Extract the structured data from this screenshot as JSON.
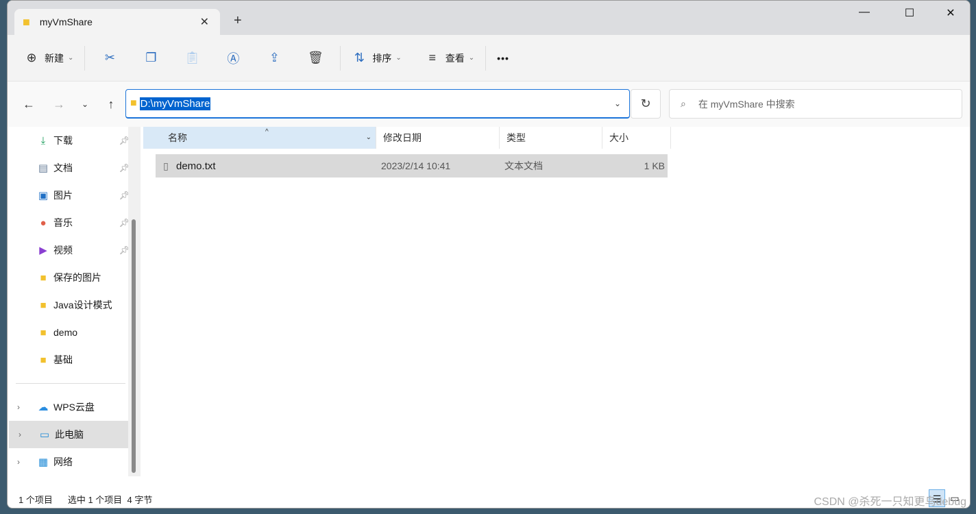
{
  "window": {
    "tab_title": "myVmShare",
    "new_tab": "+",
    "minimize": "—",
    "maximize": "☐",
    "close": "✕"
  },
  "toolbar": {
    "new_label": "新建",
    "sort_label": "排序",
    "view_label": "查看",
    "more": "•••",
    "icons": [
      "cut-icon",
      "copy-icon",
      "paste-icon",
      "rename-icon",
      "share-icon",
      "delete-icon"
    ]
  },
  "nav": {
    "address": "D:\\myVmShare",
    "search_placeholder": "在 myVmShare 中搜索"
  },
  "sidebar": {
    "quick": [
      {
        "label": "下载",
        "icon": "download-icon",
        "pinned": true
      },
      {
        "label": "文档",
        "icon": "documents-icon",
        "pinned": true
      },
      {
        "label": "图片",
        "icon": "pictures-icon",
        "pinned": true
      },
      {
        "label": "音乐",
        "icon": "music-icon",
        "pinned": true
      },
      {
        "label": "视频",
        "icon": "videos-icon",
        "pinned": true
      },
      {
        "label": "保存的图片",
        "icon": "folder-icon"
      },
      {
        "label": "Java设计模式",
        "icon": "folder-icon"
      },
      {
        "label": "demo",
        "icon": "folder-icon"
      },
      {
        "label": "基础",
        "icon": "folder-icon"
      }
    ],
    "roots": [
      {
        "label": "WPS云盘",
        "icon": "cloud-icon"
      },
      {
        "label": "此电脑",
        "icon": "computer-icon",
        "active": true
      },
      {
        "label": "网络",
        "icon": "network-icon"
      }
    ]
  },
  "columns": {
    "name": "名称",
    "modified": "修改日期",
    "type": "类型",
    "size": "大小"
  },
  "files": [
    {
      "name": "demo.txt",
      "modified": "2023/2/14 10:41",
      "type": "文本文档",
      "size": "1 KB"
    }
  ],
  "status": {
    "count": "1 个项目",
    "selected": "选中 1 个项目  4 字节"
  },
  "watermark": "CSDN @杀死一只知更鸟debug"
}
